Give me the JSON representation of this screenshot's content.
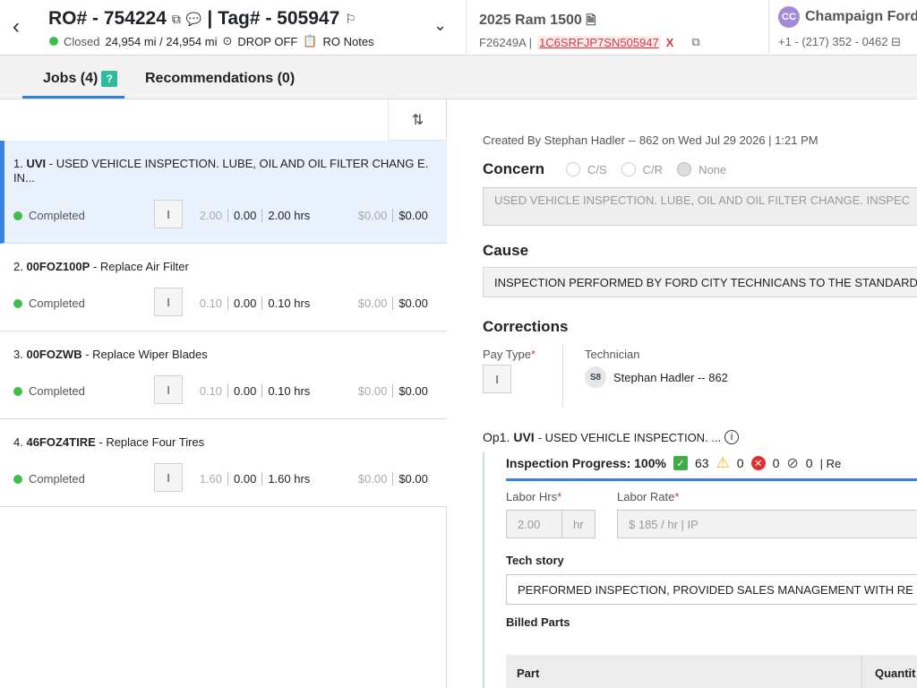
{
  "header": {
    "ro_label": "RO# - 754224",
    "tag_label": "| Tag# - 505947",
    "status": "Closed",
    "mileage": "24,954 mi / 24,954 mi",
    "drop_off": "DROP OFF",
    "ro_notes": "RO Notes",
    "vehicle": "2025 Ram 1500",
    "stock": "F26249A |",
    "vin": "1C6SRFJP7SN505947",
    "customer_initials": "CC",
    "customer_name": "Champaign Ford",
    "customer_phone": "+1 - (217) 352 - 0462"
  },
  "tabs": {
    "jobs": "Jobs (4)",
    "recommendations": "Recommendations (0)"
  },
  "jobs": [
    {
      "num": "1.",
      "code": "UVI",
      "desc": " - USED VEHICLE INSPECTION. LUBE, OIL AND OIL FILTER CHANG E. IN...",
      "status": "Completed",
      "pay": "I",
      "v1": "2.00",
      "v2": "0.00",
      "hrs": "2.00 hrs",
      "cost1": "$0.00",
      "cost2": "$0.00"
    },
    {
      "num": "2.",
      "code": "00FOZ100P",
      "desc": " - Replace Air Filter",
      "status": "Completed",
      "pay": "I",
      "v1": "0.10",
      "v2": "0.00",
      "hrs": "0.10 hrs",
      "cost1": "$0.00",
      "cost2": "$0.00"
    },
    {
      "num": "3.",
      "code": "00FOZWB",
      "desc": " - Replace Wiper Blades",
      "status": "Completed",
      "pay": "I",
      "v1": "0.10",
      "v2": "0.00",
      "hrs": "0.10 hrs",
      "cost1": "$0.00",
      "cost2": "$0.00"
    },
    {
      "num": "4.",
      "code": "46FOZ4TIRE",
      "desc": " - Replace Four Tires",
      "status": "Completed",
      "pay": "I",
      "v1": "1.60",
      "v2": "0.00",
      "hrs": "1.60 hrs",
      "cost1": "$0.00",
      "cost2": "$0.00"
    }
  ],
  "detail": {
    "created": "Created By Stephan Hadler -- 862 on Wed Jul 29 2026 | 1:21 PM",
    "concern_label": "Concern",
    "radio_cs": "C/S",
    "radio_cr": "C/R",
    "radio_none": "None",
    "concern_text": "USED VEHICLE INSPECTION. LUBE, OIL AND OIL FILTER CHANGE. INSPEC",
    "cause_label": "Cause",
    "cause_text": "INSPECTION PERFORMED BY FORD CITY TECHNICANS TO THE STANDARD",
    "corrections_label": "Corrections",
    "pay_type_label": "Pay Type",
    "pay_type_value": "I",
    "technician_label": "Technician",
    "tech_initials": "S8",
    "tech_name": "Stephan Hadler -- 862",
    "op_prefix": "Op1.",
    "op_code": "UVI",
    "op_desc": "- USED VEHICLE INSPECTION. ...",
    "inspection_progress": "Inspection Progress: 100%",
    "count_pass": "63",
    "count_warn": "0",
    "count_fail": "0",
    "count_na": "0",
    "count_more": "| Re",
    "labor_hrs_label": "Labor Hrs",
    "labor_hrs_value": "2.00",
    "labor_hrs_unit": "hr",
    "labor_rate_label": "Labor Rate",
    "labor_rate_value": "$ 185 / hr | IP",
    "tech_story_label": "Tech story",
    "tech_story_text": "PERFORMED INSPECTION, PROVIDED SALES MANAGEMENT WITH RE",
    "billed_parts_label": "Billed Parts",
    "col_part": "Part",
    "col_quantity": "Quantit"
  },
  "colors": {
    "accent": "#3b82e0",
    "status_green": "#3fbf4a",
    "vin_red": "#d9363e",
    "avatar_purple": "#a48ad8"
  }
}
